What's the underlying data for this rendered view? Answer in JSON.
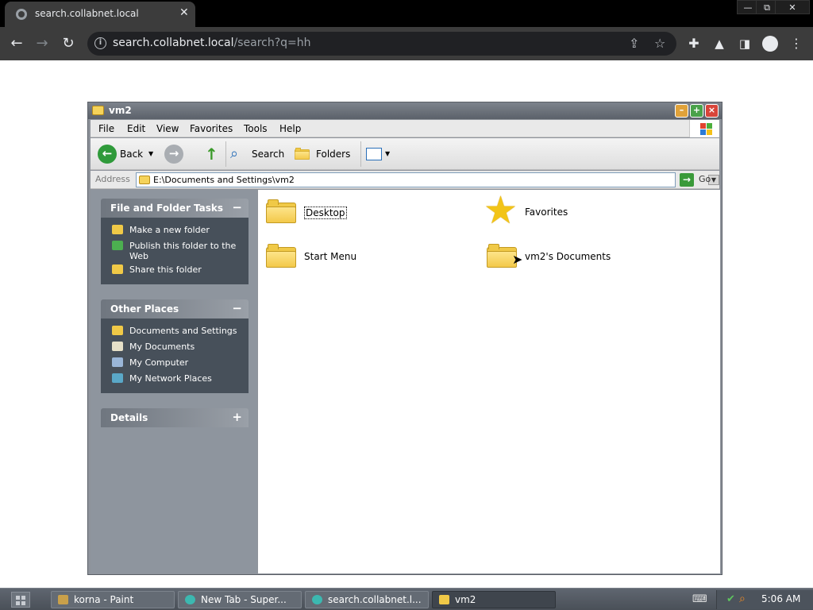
{
  "browser": {
    "tab_title": "search.collabnet.local",
    "tab_close": "✕",
    "url_host": "search.collabnet.local",
    "url_rest": "/search?q=hh",
    "controls": {
      "minimize": "—",
      "restore": "⧉",
      "close": "✕"
    }
  },
  "window": {
    "title": "vm2",
    "menu": [
      "File",
      "Edit",
      "View",
      "Favorites",
      "Tools",
      "Help"
    ],
    "toolbar": {
      "back": "Back",
      "search": "Search",
      "folders": "Folders"
    },
    "address": {
      "label": "Address",
      "value": "E:\\Documents and Settings\\vm2",
      "go": "Go"
    }
  },
  "taskpane": {
    "panels": [
      {
        "title": "File and Folder Tasks",
        "toggle": "−",
        "items": [
          "Make a new folder",
          "Publish this folder to the Web",
          "Share this folder"
        ]
      },
      {
        "title": "Other Places",
        "toggle": "−",
        "items": [
          "Documents and Settings",
          "My Documents",
          "My Computer",
          "My Network Places"
        ]
      },
      {
        "title": "Details",
        "toggle": "+",
        "items": []
      }
    ]
  },
  "content": {
    "items": [
      {
        "label": "Desktop",
        "icon": "folder-icon"
      },
      {
        "label": "Favorites",
        "icon": "star-icon"
      },
      {
        "label": "Start Menu",
        "icon": "folder-icon"
      },
      {
        "label": "vm2's Documents",
        "icon": "folder-icon"
      }
    ]
  },
  "taskbar": {
    "tasks": [
      "korna - Paint",
      "New Tab - Super...",
      "search.collabnet.l...",
      "vm2"
    ],
    "clock": "5:06 AM"
  }
}
